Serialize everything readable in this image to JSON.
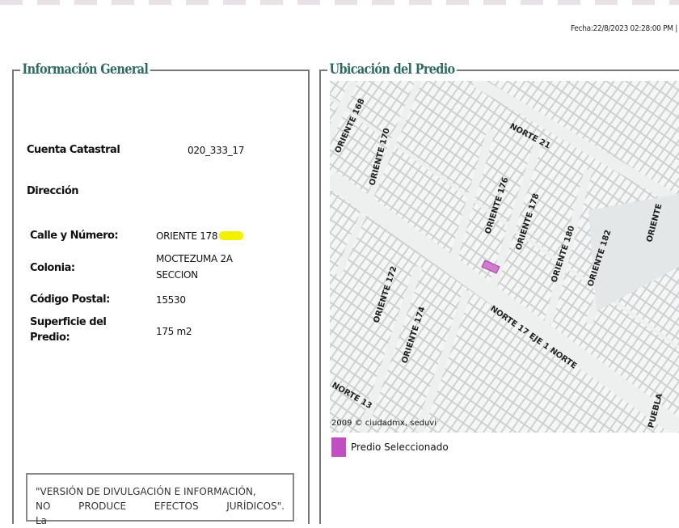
{
  "header": {
    "fecha": "Fecha:22/8/2023 02:28:00 PM |"
  },
  "general": {
    "title": "Información General",
    "cuenta_label": "Cuenta Catastral",
    "cuenta_value": "020_333_17",
    "direccion_label": "Dirección",
    "calle_label": "Calle y Número:",
    "calle_value": "ORIENTE 178",
    "colonia_label": "Colonia:",
    "colonia_value_1": "MOCTEZUMA 2A",
    "colonia_value_2": "SECCION",
    "cp_label": "Código Postal:",
    "cp_value": "15530",
    "superficie_label_1": "Superficie del",
    "superficie_label_2": "Predio:",
    "superficie_value": "175 m2",
    "note_line_1": "\"VERSIÓN DE DIVULGACIÓN E INFORMACIÓN,",
    "note_line_2": "NO PRODUCE EFECTOS JURÍDICOS\". La"
  },
  "ubicacion": {
    "title": "Ubicación del Predio",
    "streets": [
      "ORIENTE 168",
      "ORIENTE 170",
      "NORTE 21",
      "ORIENTE 176",
      "ORIENTE 178",
      "ORIENTE 180",
      "ORIENTE 182",
      "ORIENTE 172",
      "ORIENTE 174",
      "NORTE 17 EJE 1 NORTE",
      "NORTE 13",
      "ORIENTE",
      "PUEBLA"
    ],
    "copyright": "2009 © ciudadmx, seduvi",
    "legend_label": "Predio Seleccionado",
    "highlight_color": "#c24fc2"
  }
}
